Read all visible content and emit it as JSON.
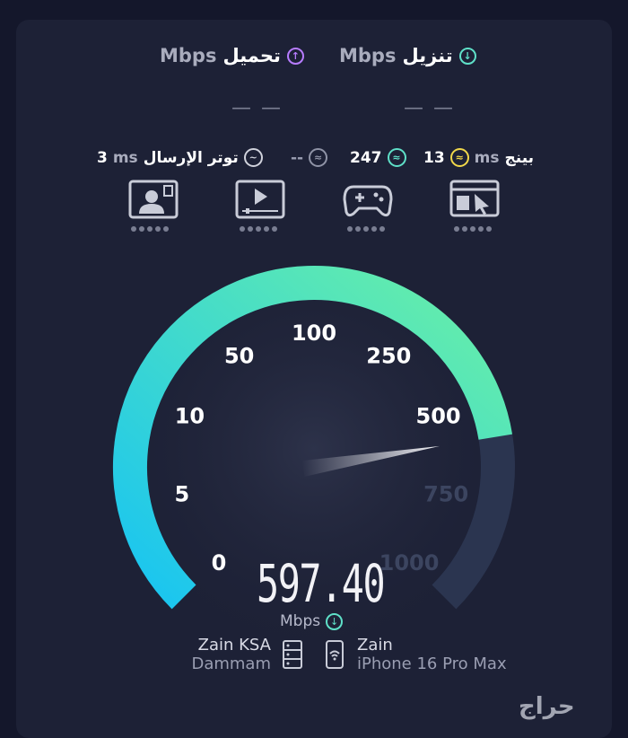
{
  "header": {
    "download_label": "تنزيل",
    "download_unit": "Mbps",
    "upload_label": "تحميل",
    "upload_unit": "Mbps",
    "download_placeholder": "— —",
    "upload_placeholder": "— —"
  },
  "metrics": {
    "ping_label": "بينج",
    "ping_unit": "ms",
    "ping_value": "13",
    "download_latency": "247",
    "upload_latency": "--",
    "jitter_label": "توتر الإرسال",
    "jitter_unit": "ms",
    "jitter_value": "3"
  },
  "quality_icons": [
    "browsing-icon",
    "gaming-icon",
    "video-streaming-icon",
    "video-call-icon"
  ],
  "gauge": {
    "labels": [
      "0",
      "5",
      "10",
      "50",
      "100",
      "250",
      "500",
      "750",
      "1000"
    ],
    "current_value": 597.4,
    "display_value": "597.40",
    "unit": "Mbps",
    "colors": {
      "start": "#18c4f2",
      "end": "#6af0a6",
      "track": "#2b3550",
      "needle": "#e6e7ec"
    }
  },
  "server": {
    "provider": "Zain KSA",
    "city": "Dammam"
  },
  "client": {
    "isp": "Zain",
    "device": "iPhone 16 Pro Max"
  },
  "watermark": "حراج"
}
